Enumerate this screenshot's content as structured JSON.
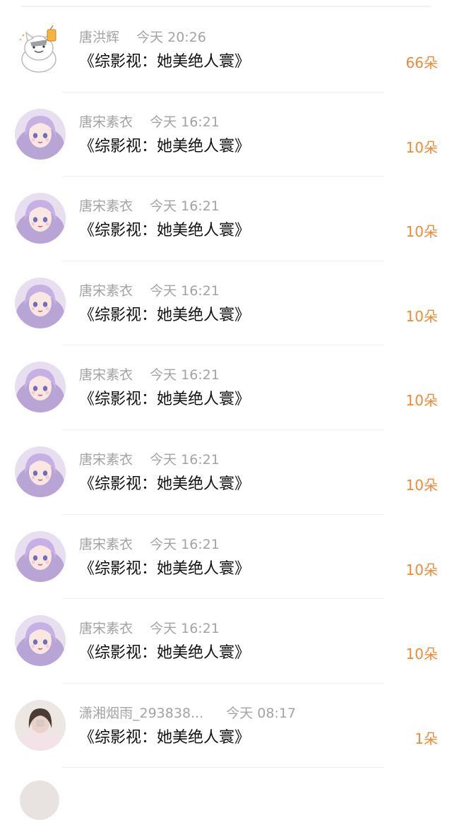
{
  "rows": [
    {
      "name": "唐洪辉",
      "time": "今天 20:26",
      "title": "《综影视：她美绝人寰》",
      "gift": "66朵",
      "avatar": "cat-avatar"
    },
    {
      "name": "唐宋素衣",
      "time": "今天 16:21",
      "title": "《综影视：她美绝人寰》",
      "gift": "10朵",
      "avatar": "anime-girl-avatar"
    },
    {
      "name": "唐宋素衣",
      "time": "今天 16:21",
      "title": "《综影视：她美绝人寰》",
      "gift": "10朵",
      "avatar": "anime-girl-avatar"
    },
    {
      "name": "唐宋素衣",
      "time": "今天 16:21",
      "title": "《综影视：她美绝人寰》",
      "gift": "10朵",
      "avatar": "anime-girl-avatar"
    },
    {
      "name": "唐宋素衣",
      "time": "今天 16:21",
      "title": "《综影视：她美绝人寰》",
      "gift": "10朵",
      "avatar": "anime-girl-avatar"
    },
    {
      "name": "唐宋素衣",
      "time": "今天 16:21",
      "title": "《综影视：她美绝人寰》",
      "gift": "10朵",
      "avatar": "anime-girl-avatar"
    },
    {
      "name": "唐宋素衣",
      "time": "今天 16:21",
      "title": "《综影视：她美绝人寰》",
      "gift": "10朵",
      "avatar": "anime-girl-avatar"
    },
    {
      "name": "唐宋素衣",
      "time": "今天 16:21",
      "title": "《综影视：她美绝人寰》",
      "gift": "10朵",
      "avatar": "anime-girl-avatar"
    },
    {
      "name": "潇湘烟雨_293838...",
      "time": "今天 08:17",
      "title": "《综影视：她美绝人寰》",
      "gift": "1朵",
      "avatar": "photo-girl-avatar"
    }
  ],
  "colors": {
    "gift": "#f08a35",
    "meta": "#a3a3a3",
    "title": "#111111"
  }
}
